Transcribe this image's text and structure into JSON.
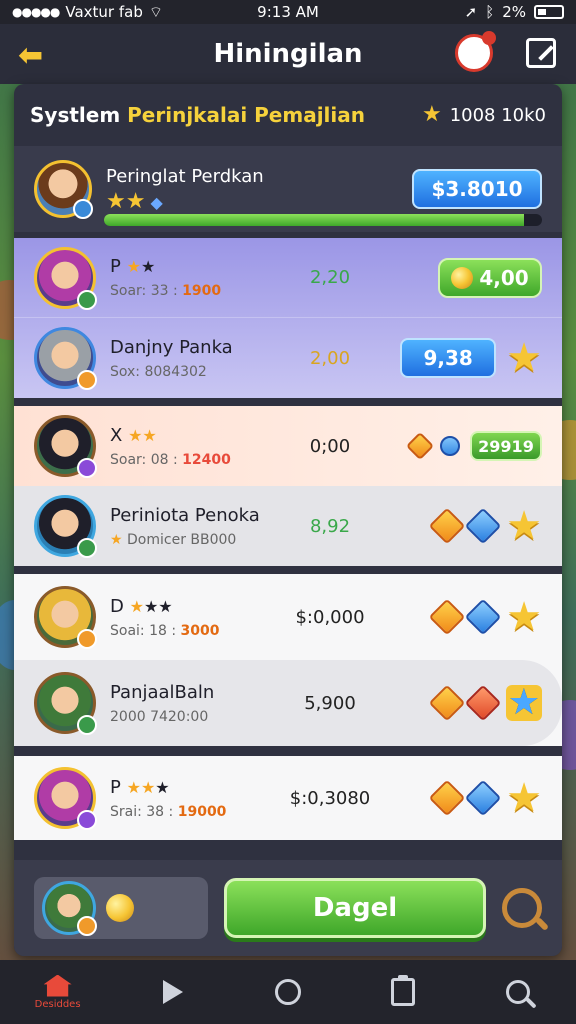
{
  "statusbar": {
    "carrier": "Vaxtur fab",
    "time": "9:13 AM",
    "battery": "2%"
  },
  "header": {
    "title": "Hiningilan",
    "back_icon": "arrow-left-icon",
    "mascot_icon": "mascot-icon",
    "edit_icon": "edit-icon"
  },
  "panel": {
    "system_title_part1": "Systlem ",
    "system_title_part2": "Perinjkalai Pemajlian",
    "total_value": "1008 10k0",
    "me": {
      "name": "Peringlat Perdkan",
      "stars": "★★",
      "button": "$3.8010",
      "progress_fraction": 0.96
    }
  },
  "groups": [
    {
      "rows": [
        {
          "name": "P",
          "stars": "★",
          "darkstar": "★",
          "score_label": "Soar: 33 : ",
          "score_val": "1900",
          "num": "2,20",
          "right_kind": "green-pill",
          "right_value": "4,00"
        },
        {
          "name": "Danjny Panka",
          "stars": "",
          "darkstar": "",
          "score_label": "Sox: 8084302",
          "score_val": "",
          "num": "2,00",
          "right_kind": "blue-chip",
          "right_value": "9,38"
        }
      ]
    },
    {
      "rows": [
        {
          "name": "X",
          "stars": "★★",
          "darkstar": "",
          "score_label": "Soar: 08 : ",
          "score_val": "12400",
          "num": "0;00",
          "right_kind": "green-tag",
          "right_value": "29919"
        },
        {
          "name": "Periniota Penoka",
          "stars": "★",
          "darkstar": "",
          "score_label": "Domicer BB000",
          "score_val": "",
          "num": "8,92",
          "right_kind": "gems-star",
          "right_value": ""
        }
      ]
    },
    {
      "rows": [
        {
          "name": "D",
          "stars": "★",
          "darkstar": "★★",
          "score_label": "Soai: 18 : ",
          "score_val": "3000",
          "num": "$:0,000",
          "right_kind": "gems-star",
          "right_value": ""
        },
        {
          "name": "PanjaalBaln",
          "stars": "",
          "darkstar": "",
          "score_label": "2000 7420:00",
          "score_val": "",
          "num": "5,900",
          "right_kind": "gems-star2",
          "right_value": ""
        }
      ]
    },
    {
      "rows": [
        {
          "name": "P",
          "stars": "★★",
          "darkstar": "★",
          "score_label": "Srai: 38 : ",
          "score_val": "19000",
          "num": "$:0,3080",
          "right_kind": "gems-star",
          "right_value": ""
        }
      ]
    }
  ],
  "bottom": {
    "cta": "Dagel"
  },
  "nav": {
    "home_label": "Desiddes"
  },
  "colors": {
    "panel": "#2f3140",
    "accent_blue": "#1f6fe0",
    "accent_green": "#3fa72a",
    "gold": "#f6c534"
  }
}
